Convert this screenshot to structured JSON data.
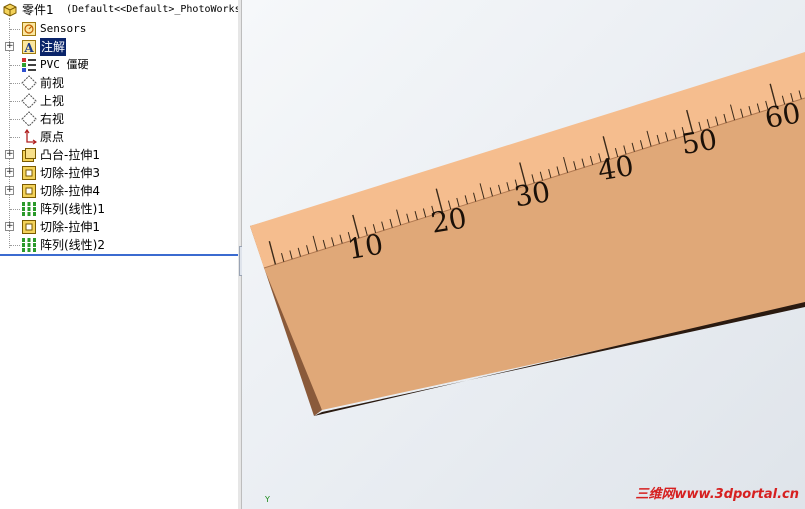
{
  "tree": {
    "root": {
      "label": "零件1",
      "config": "(Default<<Default>_PhotoWorks"
    },
    "items": [
      {
        "label": "Sensors",
        "icon": "sensor-icon"
      },
      {
        "label": "注解",
        "icon": "annotation-icon",
        "selected": true
      },
      {
        "label": "PVC 僵硬",
        "icon": "material-icon"
      },
      {
        "label": "前视",
        "icon": "plane-icon"
      },
      {
        "label": "上视",
        "icon": "plane-icon"
      },
      {
        "label": "右视",
        "icon": "plane-icon"
      },
      {
        "label": "原点",
        "icon": "origin-icon"
      },
      {
        "label": "凸台-拉伸1",
        "icon": "extrude-icon"
      },
      {
        "label": "切除-拉伸3",
        "icon": "cut-extrude-icon"
      },
      {
        "label": "切除-拉伸4",
        "icon": "cut-extrude-icon"
      },
      {
        "label": "阵列(线性)1",
        "icon": "linear-pattern-icon"
      },
      {
        "label": "切除-拉伸1",
        "icon": "cut-extrude-icon"
      },
      {
        "label": "阵列(线性)2",
        "icon": "linear-pattern-icon"
      }
    ]
  },
  "viewport": {
    "ruler_labels": [
      "10",
      "20",
      "30",
      "40",
      "50",
      "60"
    ],
    "axis_label": "Y",
    "watermark": "三维网www.3dportal.cn"
  },
  "colors": {
    "ruler_top": "#f5bd8e",
    "ruler_face": "#e0a878",
    "ruler_edge": "#8a5a3a",
    "selection": "#0a246a",
    "watermark": "#d62020"
  }
}
